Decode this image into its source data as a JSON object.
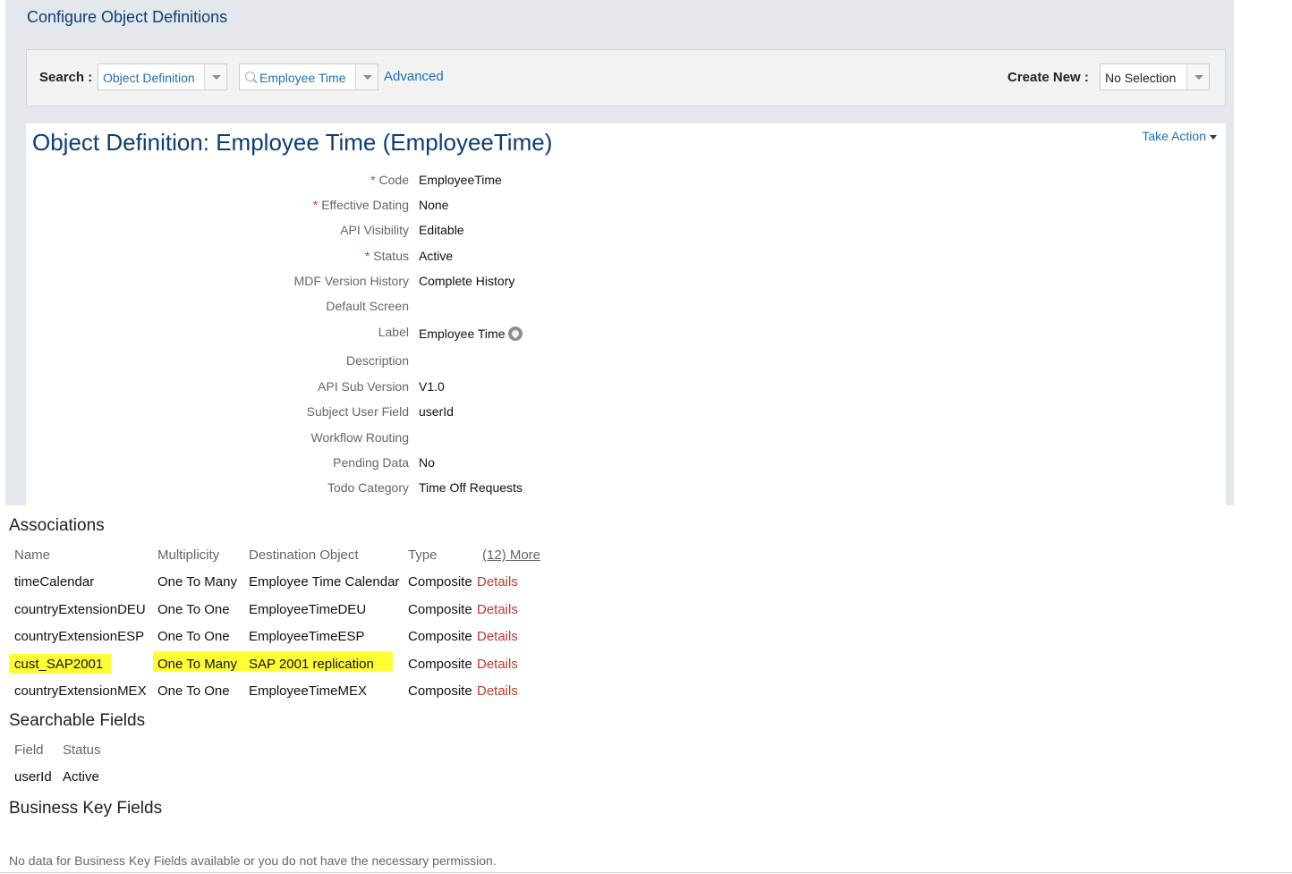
{
  "page": {
    "title": "Configure Object Definitions"
  },
  "search": {
    "label": "Search :",
    "type_value": "Object Definition",
    "query_value": "Employee Time",
    "advanced_label": "Advanced",
    "create_label": "Create New :",
    "create_value": "No Selection"
  },
  "object": {
    "title": "Object Definition: Employee Time (EmployeeTime)",
    "take_action_label": "Take Action",
    "fields": [
      {
        "label": "Code",
        "value": "EmployeeTime",
        "required": true
      },
      {
        "label": "Effective Dating",
        "value": "None",
        "required": true
      },
      {
        "label": "API Visibility",
        "value": "Editable",
        "required": false
      },
      {
        "label": "Status",
        "value": "Active",
        "required": true
      },
      {
        "label": "MDF Version History",
        "value": "Complete History",
        "required": false
      },
      {
        "label": "Default Screen",
        "value": "",
        "required": false
      },
      {
        "label": "Label",
        "value": "Employee Time",
        "required": false
      },
      {
        "label": "Description",
        "value": "",
        "required": false
      },
      {
        "label": "API Sub Version",
        "value": "V1.0",
        "required": false
      },
      {
        "label": "Subject User Field",
        "value": "userId",
        "required": false
      },
      {
        "label": "Workflow Routing",
        "value": "",
        "required": false
      },
      {
        "label": "Pending Data",
        "value": "No",
        "required": false
      },
      {
        "label": "Todo Category",
        "value": "Time Off Requests",
        "required": false
      }
    ],
    "required_marker": "*"
  },
  "associations": {
    "title": "Associations",
    "columns": [
      "Name",
      "Multiplicity",
      "Destination Object",
      "Type"
    ],
    "more_label": "(12) More",
    "details_label": "Details",
    "rows": [
      {
        "name": "timeCalendar",
        "multiplicity": "One To Many",
        "destination": "Employee Time Calendar",
        "type": "Composite",
        "highlighted": false
      },
      {
        "name": "countryExtensionDEU",
        "multiplicity": "One To One",
        "destination": "EmployeeTimeDEU",
        "type": "Composite",
        "highlighted": false
      },
      {
        "name": "countryExtensionESP",
        "multiplicity": "One To One",
        "destination": "EmployeeTimeESP",
        "type": "Composite",
        "highlighted": false
      },
      {
        "name": "cust_SAP2001",
        "multiplicity": "One To Many",
        "destination": "SAP 2001 replication",
        "type": "Composite",
        "highlighted": true
      },
      {
        "name": "countryExtensionMEX",
        "multiplicity": "One To One",
        "destination": "EmployeeTimeMEX",
        "type": "Composite",
        "highlighted": false
      }
    ],
    "highlight_color": "#ffff33"
  },
  "searchable": {
    "title": "Searchable Fields",
    "columns": [
      "Field",
      "Status"
    ],
    "rows": [
      {
        "field": "userId",
        "status": "Active"
      }
    ]
  },
  "business_key": {
    "title": "Business Key Fields",
    "empty_message": "No data for Business Key Fields available or you do not have the necessary permission."
  },
  "colors": {
    "title_blue": "#0b3d7a",
    "link_blue": "#1f6fb4",
    "details_red": "#c0392b",
    "panel_grey": "#e4e8ec"
  }
}
